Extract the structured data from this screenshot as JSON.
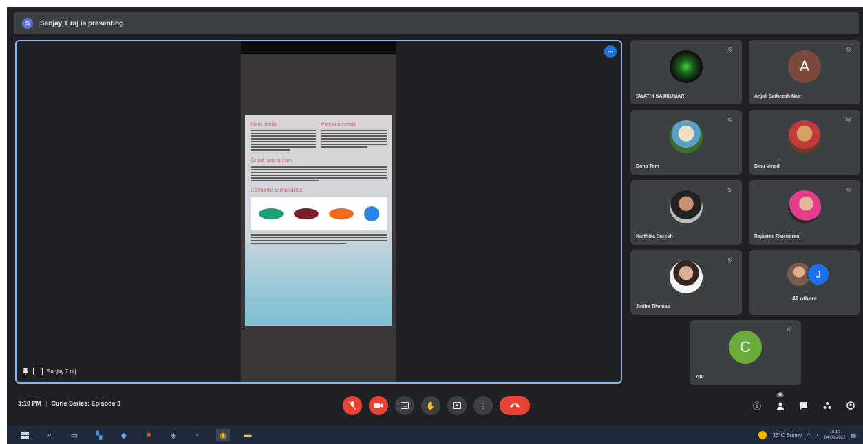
{
  "presenting_bar": {
    "badge": "S",
    "text": "Sanjay T raj is presenting"
  },
  "stage": {
    "presenter_label": "Sanjay T raj",
    "document": {
      "heading_left": "Ferro metals",
      "heading_right": "Precious metals",
      "section2": "Good conductors",
      "section3": "Colourful compounds",
      "swatch_colors": [
        "#1f9e7a",
        "#7a1f2a",
        "#f06a1e",
        "#2a86e0"
      ]
    }
  },
  "participants": [
    {
      "name": "SWATHI SAJIKUMAR",
      "avatar": "photo1",
      "letter": ""
    },
    {
      "name": "Anjali Satheesh Nair",
      "avatar": "avatar-letter-a",
      "letter": "A"
    },
    {
      "name": "Dona Tom",
      "avatar": "photo2",
      "letter": ""
    },
    {
      "name": "Binu Vinod",
      "avatar": "photo3",
      "letter": ""
    },
    {
      "name": "Karthika Suresh",
      "avatar": "photo4",
      "letter": ""
    },
    {
      "name": "Rajasree Rajendran",
      "avatar": "photo5",
      "letter": ""
    },
    {
      "name": "Jintha Thomas",
      "avatar": "photo6",
      "letter": ""
    }
  ],
  "others": {
    "label": "41 others",
    "letter": "J"
  },
  "self_tile": {
    "name": "You",
    "letter": "C"
  },
  "meeting": {
    "time": "3:10 PM",
    "separator": "|",
    "title": "Curie Series: Episode 3"
  },
  "right_controls": {
    "people_count": "48"
  },
  "taskbar": {
    "weather": "36°C Sunny",
    "time": "15:10",
    "date": "04-02-2022"
  }
}
